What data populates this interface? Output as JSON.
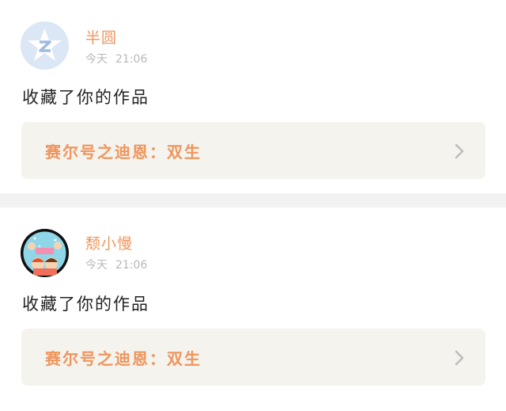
{
  "posts": [
    {
      "user": "半圆",
      "day": "今天",
      "time": "21:06",
      "action": "收藏了你的作品",
      "work_title": "赛尔号之迪恩：双生",
      "avatar_icon": "z-star-avatar-icon"
    },
    {
      "user": "颓小慢",
      "day": "今天",
      "time": "21:06",
      "action": "收藏了你的作品",
      "work_title": "赛尔号之迪恩：双生",
      "avatar_icon": "cartoon-couple-avatar-icon"
    }
  ],
  "colors": {
    "accent": "#f0955c",
    "meta": "#b8b8b8",
    "card_bg": "#f4f3ee",
    "separator": "#f2f2f2"
  }
}
